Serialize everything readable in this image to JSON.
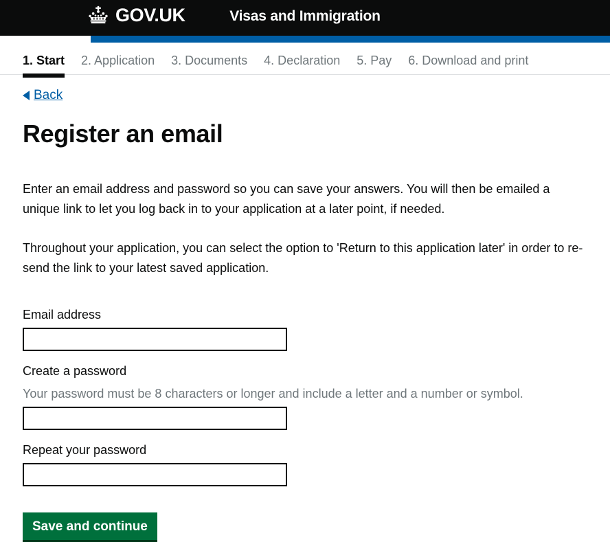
{
  "header": {
    "crown_icon": "crown-icon",
    "brand": "GOV.UK",
    "service_name": "Visas and Immigration",
    "background_color": "#0b0c0c",
    "blue_bar_color": "#005ea5"
  },
  "step_nav": {
    "steps": [
      {
        "label": "1. Start",
        "active": true
      },
      {
        "label": "2. Application",
        "active": false
      },
      {
        "label": "3. Documents",
        "active": false
      },
      {
        "label": "4. Declaration",
        "active": false
      },
      {
        "label": "5. Pay",
        "active": false
      },
      {
        "label": "6. Download and print",
        "active": false
      }
    ],
    "active_color": "#0b0c0c",
    "inactive_color": "#6f777b"
  },
  "back_link": {
    "label": "Back",
    "icon": "left-arrow-icon",
    "color": "#005ea5"
  },
  "page": {
    "title": "Register an email",
    "paragraphs": [
      "Enter an email address and password so you can save your answers. You will then be emailed a unique link to let you log back in to your application at a later point, if needed.",
      "Throughout your application, you can select the option to 'Return to this application later' in order to re-send the link to your latest saved application."
    ]
  },
  "form": {
    "email": {
      "label": "Email address",
      "value": "",
      "placeholder": ""
    },
    "password": {
      "label": "Create a password",
      "hint": "Your password must be 8 characters or longer and include a letter and a number or symbol.",
      "value": "",
      "placeholder": ""
    },
    "password_repeat": {
      "label": "Repeat your password",
      "value": "",
      "placeholder": ""
    },
    "submit_label": "Save and continue",
    "submit_color": "#00703c"
  }
}
